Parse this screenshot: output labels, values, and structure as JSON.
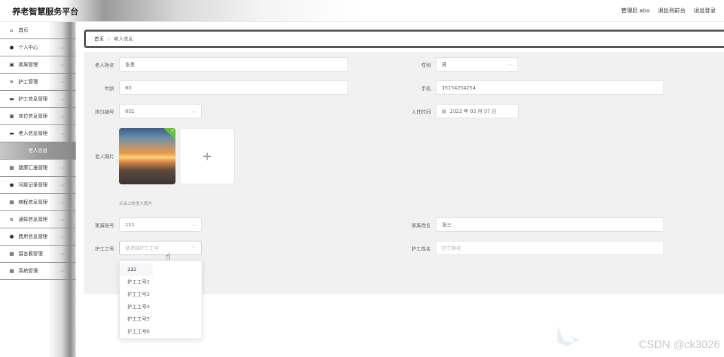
{
  "app": {
    "title": "养老智慧服务平台"
  },
  "header": {
    "user": "管理员 abo",
    "back_front": "退出到前台",
    "logout": "退出登录"
  },
  "sidebar": {
    "items": [
      {
        "icon": "home-icon",
        "glyph": "⌂",
        "label": "首页",
        "chevron": false
      },
      {
        "icon": "user-icon",
        "glyph": "●",
        "label": "个人中心",
        "chevron": true
      },
      {
        "icon": "file-icon",
        "glyph": "▣",
        "label": "家属管理",
        "chevron": true
      },
      {
        "icon": "list-icon",
        "glyph": "≡",
        "label": "护工管理",
        "chevron": true
      },
      {
        "icon": "book-icon",
        "glyph": "▬",
        "label": "护工信息管理",
        "chevron": true
      },
      {
        "icon": "file-icon",
        "glyph": "▣",
        "label": "床位信息管理",
        "chevron": true
      },
      {
        "icon": "book-icon",
        "glyph": "▬",
        "label": "老人信息管理",
        "chevron": true
      }
    ],
    "active_sub": "老人信息",
    "items_after": [
      {
        "icon": "grid-icon",
        "glyph": "▦",
        "label": "健康汇报管理",
        "chevron": true
      },
      {
        "icon": "user-icon",
        "glyph": "●",
        "label": "问题记录管理",
        "chevron": true
      },
      {
        "icon": "grid-icon",
        "glyph": "▦",
        "label": "病程信息管理",
        "chevron": true
      },
      {
        "icon": "list-icon",
        "glyph": "≡",
        "label": "通知信息管理",
        "chevron": true
      },
      {
        "icon": "user-icon",
        "glyph": "●",
        "label": "费用信息管理",
        "chevron": true
      },
      {
        "icon": "grid-icon",
        "glyph": "▦",
        "label": "留言板管理",
        "chevron": true
      },
      {
        "icon": "grid-icon",
        "glyph": "▦",
        "label": "系统管理",
        "chevron": true
      }
    ]
  },
  "breadcrumb": {
    "home": "首页",
    "sep": "/",
    "current": "老人信息"
  },
  "form": {
    "name_label": "老人姓名",
    "name_value": "张思",
    "gender_label": "性别",
    "gender_value": "男",
    "age_label": "年龄",
    "age_value": "60",
    "phone_label": "手机",
    "phone_value": "15154254254",
    "bed_label": "床位编号",
    "bed_value": "001",
    "checkin_label": "入住时间",
    "checkin_value": "2022 年 03 月 07 日",
    "photo_label": "老人照片",
    "upload_tip": "点击上传老人照片",
    "family_account_label": "家属账号",
    "family_account_value": "111",
    "family_name_label": "家属姓名",
    "family_name_value": "张三",
    "nurse_id_label": "护工工号",
    "nurse_id_placeholder": "请选择护工工号",
    "nurse_name_label": "护工姓名",
    "nurse_name_placeholder": "护工姓名"
  },
  "dropdown_options": [
    "222",
    "护工工号2",
    "护工工号3",
    "护工工号4",
    "护工工号5",
    "护工工号6"
  ],
  "watermark": "CSDN @ck3026"
}
